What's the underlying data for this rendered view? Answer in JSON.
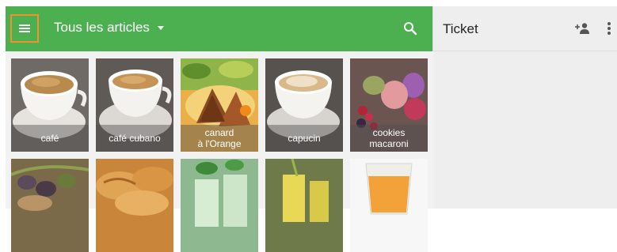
{
  "header": {
    "category_label": "Tous les articles",
    "icons": {
      "menu": "menu-icon",
      "dropdown": "chevron-down-icon",
      "search": "search-icon"
    },
    "colors": {
      "bar": "#4caf50",
      "menu_highlight": "#f0932b"
    }
  },
  "ticket": {
    "title": "Ticket",
    "icons": {
      "add_customer": "add-person-icon",
      "more": "more-vertical-icon"
    }
  },
  "items": [
    {
      "label": "café"
    },
    {
      "label": "café cubano"
    },
    {
      "label": "canard\nà l'Orange"
    },
    {
      "label": "capucin"
    },
    {
      "label": "cookies\nmacaroni"
    },
    {
      "label": ""
    },
    {
      "label": ""
    },
    {
      "label": ""
    },
    {
      "label": ""
    },
    {
      "label": ""
    }
  ]
}
